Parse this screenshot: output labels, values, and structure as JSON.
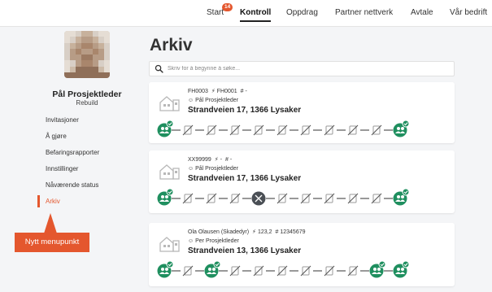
{
  "nav": {
    "items": [
      "Start",
      "Kontroll",
      "Oppdrag",
      "Partner nettverk",
      "Avtale",
      "Vår bedrift"
    ],
    "active": "Kontroll",
    "start_badge": "14"
  },
  "user": {
    "name": "Pål Prosjektleder",
    "company": "Rebuild"
  },
  "menu": {
    "items": [
      "Invitasjoner",
      "Å gjøre",
      "Befaringsrapporter",
      "Innstillinger",
      "Nåværende status",
      "Arkiv"
    ],
    "active": "Arkiv"
  },
  "callout": "Nytt menupunkt",
  "page": {
    "title": "Arkiv",
    "search_placeholder": "Skriv for å begynne å søke..."
  },
  "cards": [
    {
      "line1": "FH0003",
      "line1b": "FH0001",
      "line1c": "-",
      "person": "Pål Prosjektleder",
      "address": "Strandveien 17, 1366 Lysaker",
      "steps": [
        "done",
        "na",
        "na",
        "na",
        "na",
        "na",
        "na",
        "na",
        "na",
        "na",
        "done"
      ]
    },
    {
      "line1": "XX99999",
      "line1b": "-",
      "line1c": "-",
      "person": "Pål Prosjektleder",
      "address": "Strandveien 17, 1366 Lysaker",
      "steps": [
        "done",
        "na",
        "na",
        "na",
        "current",
        "na",
        "na",
        "na",
        "na",
        "na",
        "done"
      ]
    },
    {
      "line1": "Ola Olausen (Skadedyr)",
      "line1b": "123,2",
      "line1c": "12345679",
      "person": "Per Prosjektleder",
      "address": "Strandveien 13, 1366 Lysaker",
      "steps": [
        "done",
        "na",
        "done",
        "na",
        "na",
        "na",
        "na",
        "na",
        "na",
        "done",
        "done"
      ]
    }
  ],
  "colors": {
    "accent": "#e4572e",
    "green": "#1f8f5f",
    "dark_step": "#4a4f55",
    "gray_icon": "#9a9a9a"
  }
}
